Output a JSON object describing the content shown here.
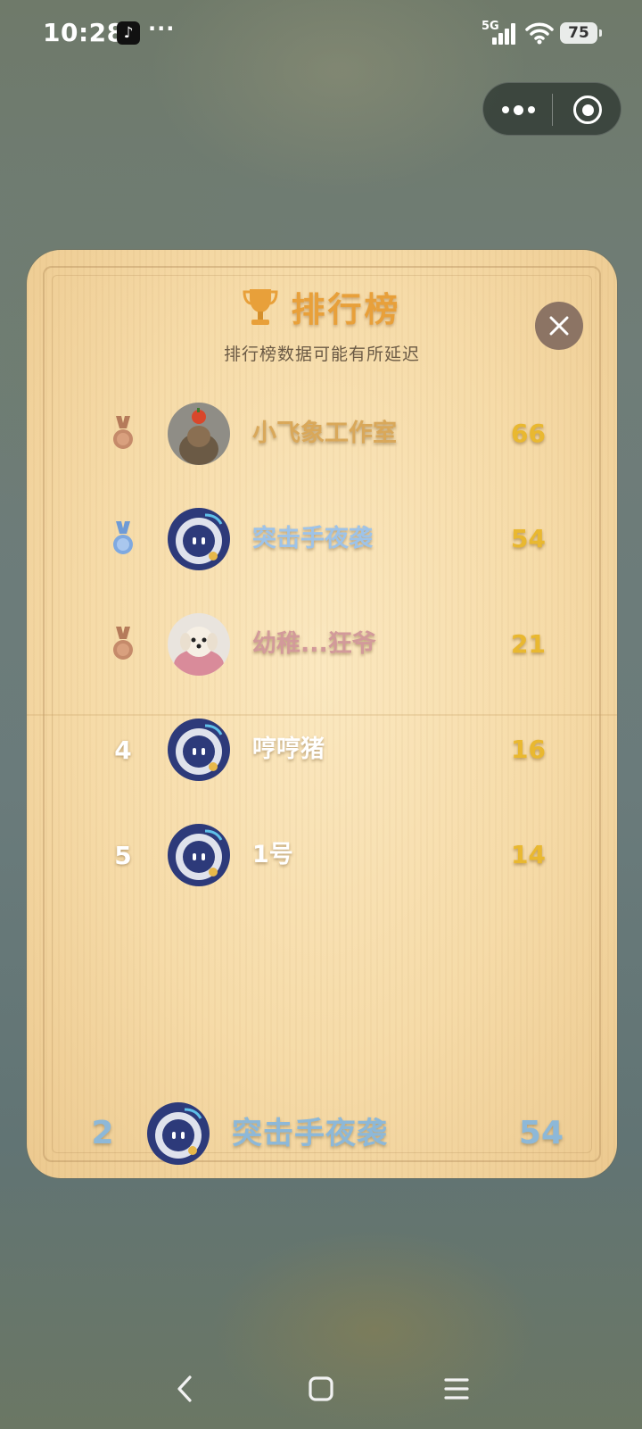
{
  "status_bar": {
    "time": "10:28",
    "dots": "···",
    "network": "5G",
    "battery": "75",
    "tiktok_glyph": "♪"
  },
  "leaderboard": {
    "title": "排行榜",
    "subtitle": "排行榜数据可能有所延迟",
    "entries": [
      {
        "rank": "1",
        "medal": "medal-gold-icon",
        "name": "小飞象工作室",
        "score": "66"
      },
      {
        "rank": "2",
        "medal": "medal-silver-icon",
        "name": "突击手夜袭",
        "score": "54"
      },
      {
        "rank": "3",
        "medal": "medal-bronze-icon",
        "name": "幼稚...狂爷",
        "score": "21"
      },
      {
        "rank": "4",
        "name": "哼哼猪",
        "score": "16"
      },
      {
        "rank": "5",
        "name": "1号",
        "score": "14"
      }
    ],
    "my_entry": {
      "rank": "2",
      "name": "突击手夜袭",
      "score": "54"
    }
  },
  "colors": {
    "gold": "#e9b830",
    "silver_text": "#9ec3e8",
    "bronze_text": "#d29a9a",
    "title": "#e8a03a",
    "close_button": "#8c7464"
  }
}
